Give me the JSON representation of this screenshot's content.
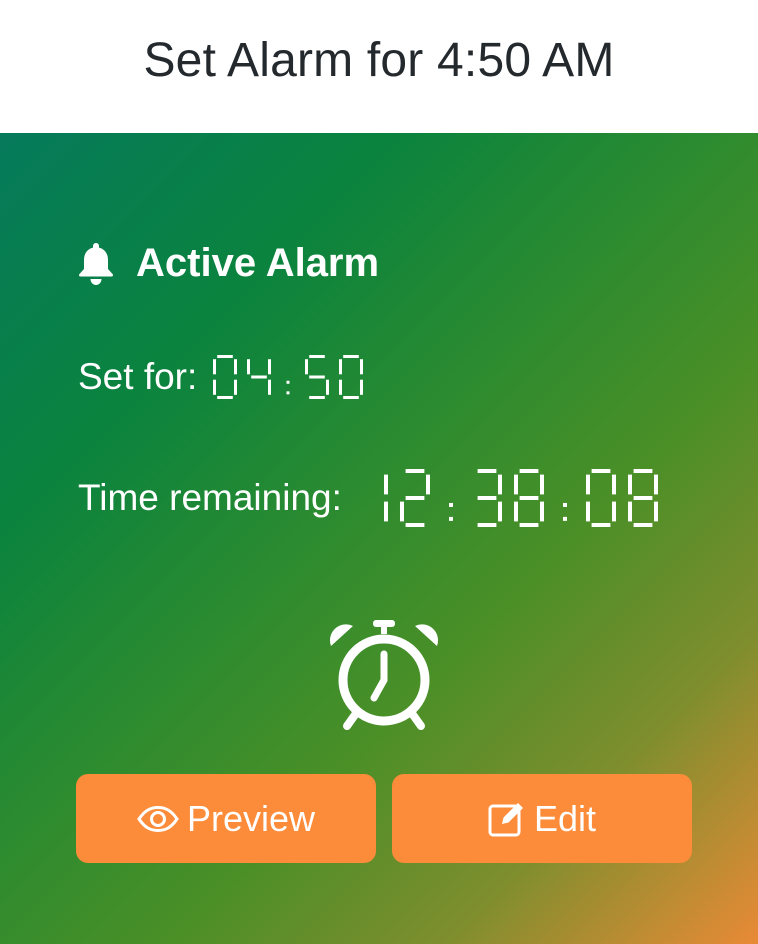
{
  "header": {
    "title": "Set Alarm for 4:50 AM"
  },
  "alarm": {
    "heading": "Active Alarm",
    "set_for_label": "Set for:",
    "set_for_value": "04:50",
    "remaining_label": "Time remaining:",
    "remaining_value": "12:38:08"
  },
  "actions": {
    "preview_label": "Preview",
    "edit_label": "Edit"
  },
  "icons": {
    "bell": "bell-icon",
    "clock": "alarm-clock-icon",
    "eye": "eye-icon",
    "edit": "edit-icon"
  },
  "colors": {
    "button": "#fc8b3a",
    "text": "#ffffff"
  }
}
